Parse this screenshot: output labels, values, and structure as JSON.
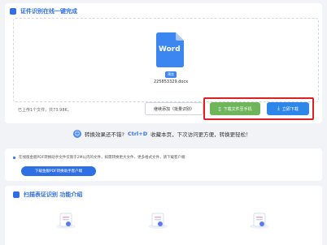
{
  "header": {
    "title": "证件识别在线一键完成"
  },
  "file": {
    "badge": "Word",
    "tag": "预览",
    "name": "225853329.docx"
  },
  "upload_info": "已上传1个文件，共73.98K。",
  "buttons": {
    "continue": "继续添加（批量识别）",
    "save_phone": "下载文件至手机",
    "download": "立即下载"
  },
  "feedback": {
    "text": "转换效果还不错?",
    "shortcut": "Ctrl+D",
    "text2": "收藏本页，下次访问更方便，转换更轻松！"
  },
  "notice": {
    "text": "在线版金舰PDF转换助手文件仅限于2M以内的文件，如需转换更大文件、更多格式文件，请下载客户端",
    "button": "下载金舰PDF转换助手客户端"
  },
  "features": {
    "title": "扫描表证识别 功能介绍"
  },
  "colors": {
    "accent": "#2f6fe6",
    "green": "#6fb65b",
    "highlight": "#e02020"
  }
}
